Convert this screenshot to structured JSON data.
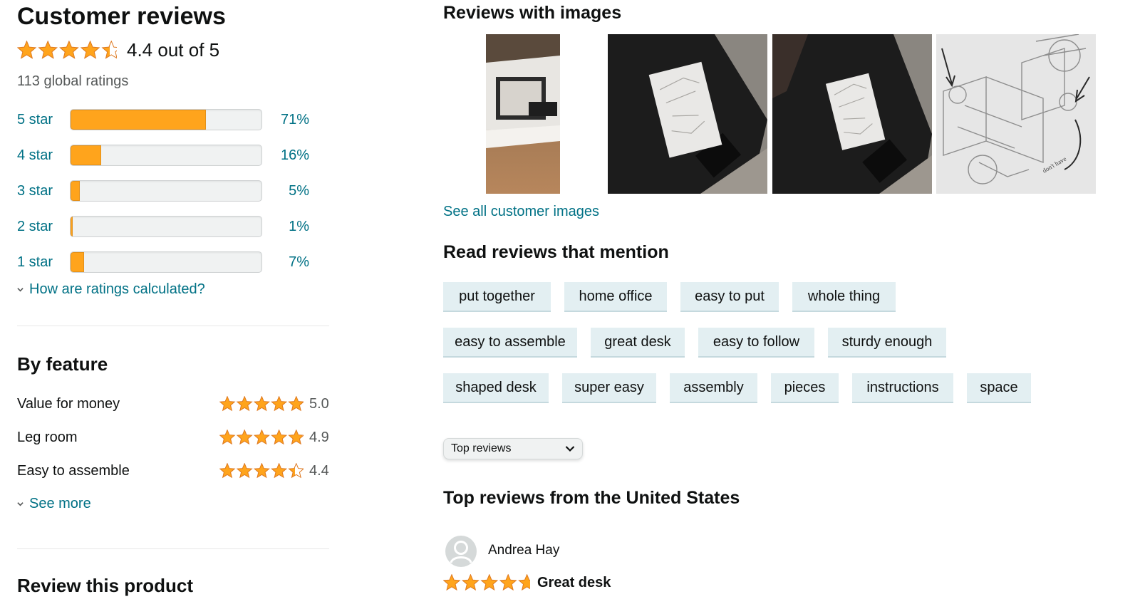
{
  "summary": {
    "title": "Customer reviews",
    "average": 4.4,
    "rating_text": "4.4 out of 5",
    "global_ratings": "113 global ratings"
  },
  "histogram": [
    {
      "label": "5 star",
      "pct": "71%",
      "value": 71
    },
    {
      "label": "4 star",
      "pct": "16%",
      "value": 16
    },
    {
      "label": "3 star",
      "pct": "5%",
      "value": 5
    },
    {
      "label": "2 star",
      "pct": "1%",
      "value": 1
    },
    {
      "label": "1 star",
      "pct": "7%",
      "value": 7
    }
  ],
  "ratings_link": "How are ratings calculated?",
  "by_feature": {
    "title": "By feature",
    "items": [
      {
        "name": "Value for money",
        "score": "5.0",
        "value": 5.0
      },
      {
        "name": "Leg room",
        "score": "4.9",
        "value": 4.9
      },
      {
        "name": "Easy to assemble",
        "score": "4.4",
        "value": 4.4
      }
    ],
    "see_more": "See more"
  },
  "review_product_title": "Review this product",
  "images_section": {
    "title": "Reviews with images",
    "see_all": "See all customer images"
  },
  "mentions": {
    "title": "Read reviews that mention",
    "chips": [
      [
        "put together",
        "home office",
        "easy to put",
        "whole thing"
      ],
      [
        "easy to assemble",
        "great desk",
        "easy to follow",
        "sturdy enough"
      ],
      [
        "shaped desk",
        "super easy",
        "assembly",
        "pieces",
        "instructions",
        "space"
      ]
    ]
  },
  "sort": {
    "selected": "Top reviews"
  },
  "top_reviews_title": "Top reviews from the United States",
  "review": {
    "author": "Andrea Hay",
    "rating": 5,
    "headline": "Great desk"
  },
  "colors": {
    "star": "#ffa41c",
    "link": "#007185",
    "chip_bg": "#e3eff2"
  }
}
